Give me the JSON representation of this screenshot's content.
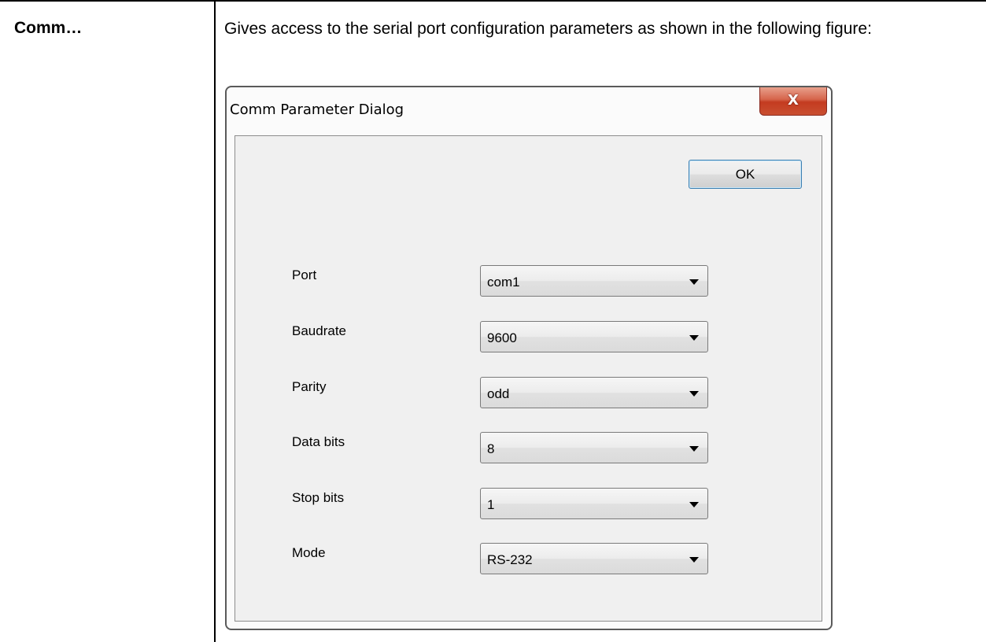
{
  "table": {
    "term": "Comm…",
    "description": "Gives access to the serial port configuration parameters as shown in the following figure:"
  },
  "dialog": {
    "title": "Comm Parameter Dialog",
    "close_icon": "close-icon",
    "close_glyph": "X",
    "ok_label": "OK",
    "fields": [
      {
        "label": "Port",
        "value": "com1"
      },
      {
        "label": "Baudrate",
        "value": "9600"
      },
      {
        "label": "Parity",
        "value": "odd"
      },
      {
        "label": "Data bits",
        "value": "8"
      },
      {
        "label": "Stop bits",
        "value": "1"
      },
      {
        "label": "Mode",
        "value": "RS-232"
      }
    ]
  },
  "colors": {
    "close_button": "#c94f30",
    "ok_border": "#3c7fb1",
    "client_background": "#f0f0f0"
  }
}
